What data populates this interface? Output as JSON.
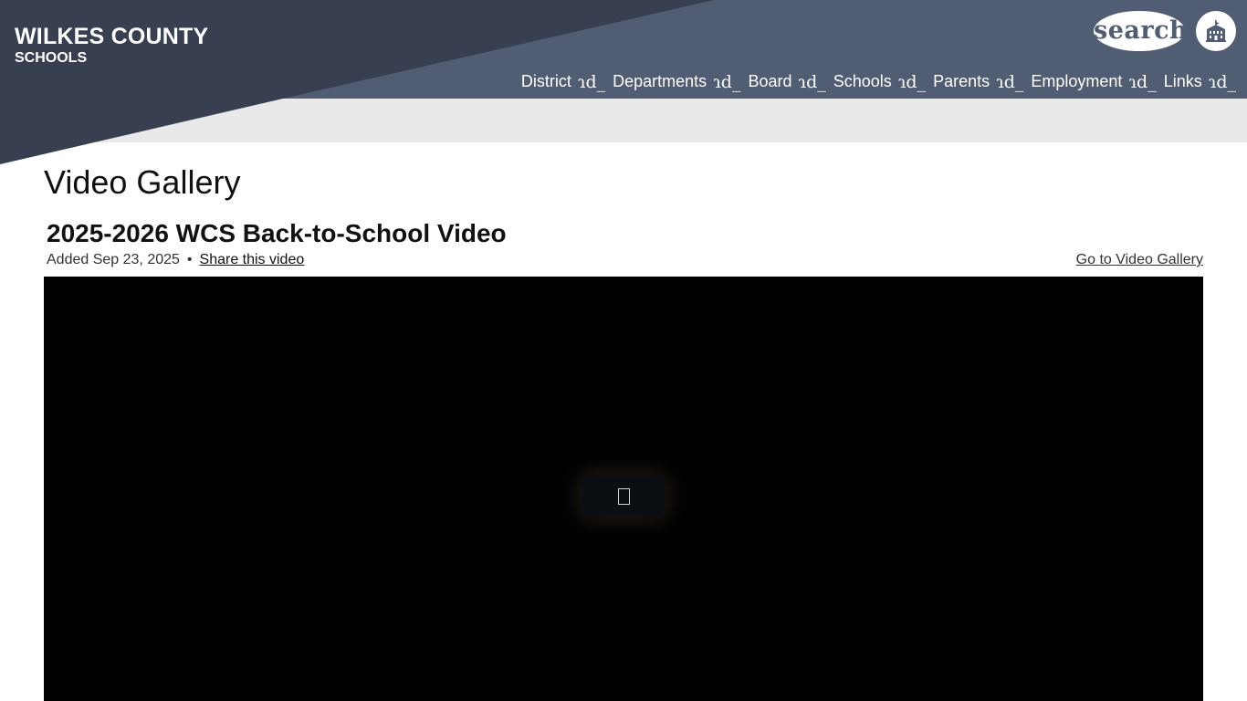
{
  "site": {
    "name": "WILKES COUNTY",
    "subtitle": "SCHOOLS"
  },
  "header": {
    "search_label": "search",
    "school_icon": "school-building-icon"
  },
  "nav": {
    "dropdown_glyph": "ɿd_",
    "items": [
      {
        "label": "District"
      },
      {
        "label": "Departments"
      },
      {
        "label": "Board"
      },
      {
        "label": "Schools"
      },
      {
        "label": "Parents"
      },
      {
        "label": "Employment"
      },
      {
        "label": "Links"
      }
    ]
  },
  "main": {
    "page_title": "Video Gallery",
    "video": {
      "title": "2025-2026 WCS Back-to-School Video",
      "added": "Added Sep 23, 2025",
      "separator": "•",
      "share_label": "Share this video",
      "gallery_link": "Go to Video Gallery"
    }
  },
  "colors": {
    "header": "#515d73",
    "header_dark": "#373f50",
    "band": "#e9e9e9",
    "player": "#000000"
  }
}
